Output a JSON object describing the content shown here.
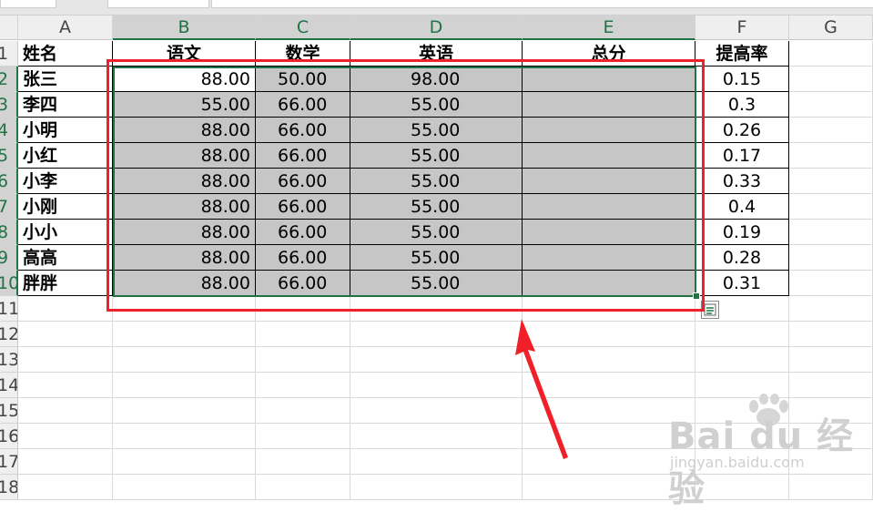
{
  "columns": [
    "A",
    "B",
    "C",
    "D",
    "E",
    "F",
    "G"
  ],
  "rows": [
    "1",
    "2",
    "3",
    "4",
    "5",
    "6",
    "7",
    "8",
    "9",
    "10",
    "11",
    "12",
    "13",
    "14",
    "15",
    "16",
    "17",
    "18"
  ],
  "header": [
    "姓名",
    "语文",
    "数学",
    "英语",
    "总分",
    "提高率"
  ],
  "data": [
    {
      "name": "张三",
      "chinese": "88.00",
      "math": "50.00",
      "english": "98.00",
      "total": "",
      "rate": "0.15"
    },
    {
      "name": "李四",
      "chinese": "55.00",
      "math": "66.00",
      "english": "55.00",
      "total": "",
      "rate": "0.3"
    },
    {
      "name": "小明",
      "chinese": "88.00",
      "math": "66.00",
      "english": "55.00",
      "total": "",
      "rate": "0.26"
    },
    {
      "name": "小红",
      "chinese": "88.00",
      "math": "66.00",
      "english": "55.00",
      "total": "",
      "rate": "0.17"
    },
    {
      "name": "小李",
      "chinese": "88.00",
      "math": "66.00",
      "english": "55.00",
      "total": "",
      "rate": "0.33"
    },
    {
      "name": "小刚",
      "chinese": "88.00",
      "math": "66.00",
      "english": "55.00",
      "total": "",
      "rate": "0.4"
    },
    {
      "name": "小小",
      "chinese": "88.00",
      "math": "66.00",
      "english": "55.00",
      "total": "",
      "rate": "0.19"
    },
    {
      "name": "高高",
      "chinese": "88.00",
      "math": "66.00",
      "english": "55.00",
      "total": "",
      "rate": "0.28"
    },
    {
      "name": "胖胖",
      "chinese": "88.00",
      "math": "66.00",
      "english": "55.00",
      "total": "",
      "rate": "0.31"
    }
  ],
  "watermark": {
    "brand": "Bai du 经验",
    "site": "jingyan.baidu.com"
  },
  "colors": {
    "selection": "#217346",
    "highlight": "#c6c6c6",
    "annotation": "#f0202a"
  },
  "icons": {
    "quick_analysis": "quick-analysis-icon",
    "annotation": "red-arrow"
  }
}
